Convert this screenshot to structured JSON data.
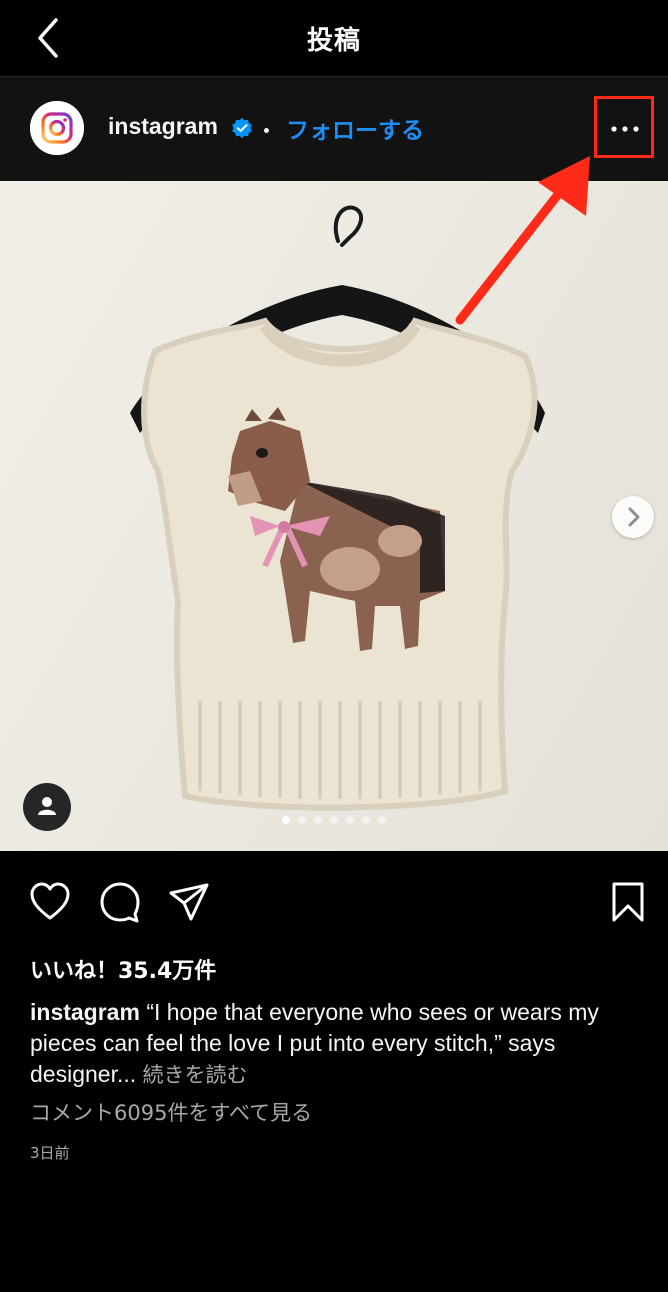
{
  "topbar": {
    "title": "投稿"
  },
  "post": {
    "username": "instagram",
    "follow_label": "フォローする",
    "likes": "いいね！35.4万件",
    "caption_user": "instagram",
    "caption_text": "“I hope that everyone who sees or wears my pieces can feel the love I put into every stitch,” says designer...",
    "read_more": "続きを読む",
    "view_comments": "コメント6095件をすべて見る",
    "timestamp": "3日前"
  },
  "carousel": {
    "total": 7,
    "current": 1
  },
  "colors": {
    "accent_blue": "#1f8ef5",
    "highlight_red": "#ff2a17",
    "background": "#000000"
  },
  "icons": [
    "back-chevron-icon",
    "verified-badge-icon",
    "more-options-icon",
    "next-arrow-icon",
    "user-tag-icon",
    "heart-icon",
    "comment-icon",
    "share-icon",
    "bookmark-icon"
  ]
}
